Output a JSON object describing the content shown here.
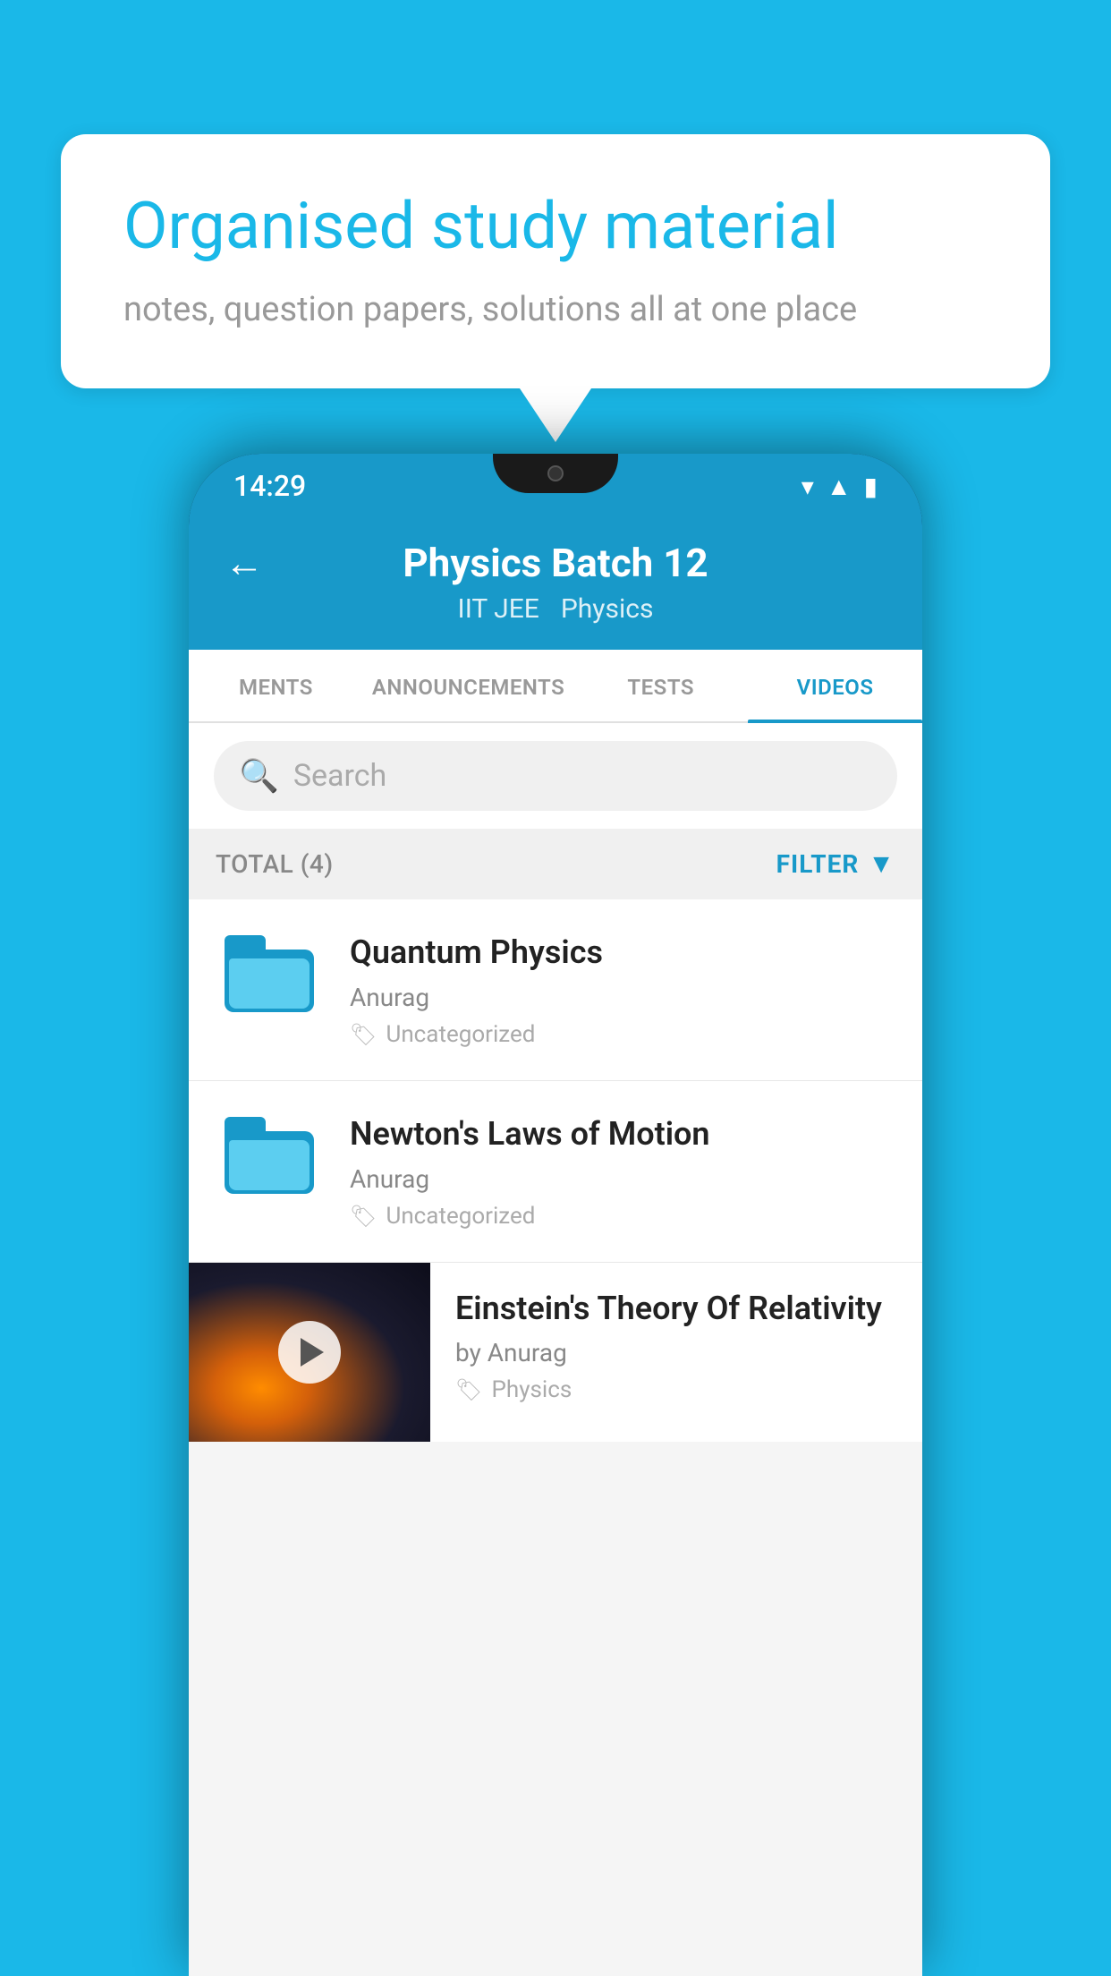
{
  "background": {
    "color": "#1ab8e8"
  },
  "speech_bubble": {
    "title": "Organised study material",
    "subtitle": "notes, question papers, solutions all at one place"
  },
  "phone": {
    "status_bar": {
      "time": "14:29",
      "icons": [
        "wifi",
        "signal",
        "battery"
      ]
    },
    "app_bar": {
      "back_label": "←",
      "title": "Physics Batch 12",
      "tag1": "IIT JEE",
      "tag2": "Physics"
    },
    "tabs": [
      {
        "label": "MENTS",
        "active": false
      },
      {
        "label": "ANNOUNCEMENTS",
        "active": false
      },
      {
        "label": "TESTS",
        "active": false
      },
      {
        "label": "VIDEOS",
        "active": true
      }
    ],
    "search": {
      "placeholder": "Search"
    },
    "filter_bar": {
      "total_label": "TOTAL (4)",
      "filter_label": "FILTER"
    },
    "videos": [
      {
        "id": 1,
        "title": "Quantum Physics",
        "author": "Anurag",
        "tag": "Uncategorized",
        "has_thumbnail": false
      },
      {
        "id": 2,
        "title": "Newton's Laws of Motion",
        "author": "Anurag",
        "tag": "Uncategorized",
        "has_thumbnail": false
      },
      {
        "id": 3,
        "title": "Einstein's Theory Of Relativity",
        "author": "by Anurag",
        "tag": "Physics",
        "has_thumbnail": true
      }
    ]
  }
}
